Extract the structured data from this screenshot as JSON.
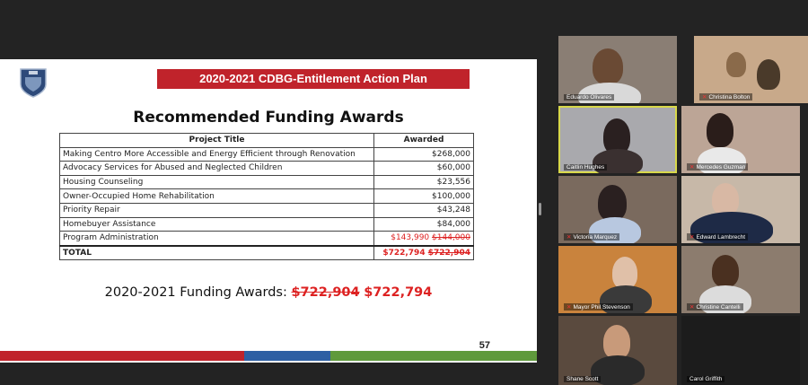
{
  "slide": {
    "banner_title": "2020-2021 CDBG-Entitlement Action Plan",
    "heading": "Recommended Funding Awards",
    "table": {
      "headers": [
        "Project Title",
        "Awarded"
      ],
      "rows": [
        {
          "title": "Making Centro More Accessible and Energy Efficient through Renovation",
          "amount": "$268,000"
        },
        {
          "title": "Advocacy Services for Abused and Neglected Children",
          "amount": "$60,000"
        },
        {
          "title": "Housing Counseling",
          "amount": "$23,556"
        },
        {
          "title": "Owner-Occupied Home Rehabilitation",
          "amount": "$100,000"
        },
        {
          "title": "Priority Repair",
          "amount": "$43,248"
        },
        {
          "title": "Homebuyer Assistance",
          "amount": "$84,000"
        }
      ],
      "program_admin": {
        "title": "Program Administration",
        "new_amount": "$143,990",
        "old_amount": "$144,000"
      },
      "total": {
        "title": "TOTAL",
        "new_amount": "$722,794",
        "old_amount": "$722,904"
      }
    },
    "summary": {
      "label": "2020-2021 Funding Awards:",
      "old_amount": "$722,904",
      "new_amount": "$722,794"
    },
    "page_number": "57",
    "colors": {
      "banner": "#c0232b",
      "bar_red": "#c0232b",
      "bar_blue": "#2e5fa3",
      "bar_green": "#5f9a3c"
    }
  },
  "participants": [
    {
      "name": "Eduardo Olivares"
    },
    {
      "name": "Christina Bolton"
    },
    {
      "name": "Caitlin Hughes"
    },
    {
      "name": "Mercedes Guzman"
    },
    {
      "name": "Victoria Marquez"
    },
    {
      "name": "Edward Lambrecht"
    },
    {
      "name": "Mayor Phil Stevenson"
    },
    {
      "name": "Christine Cantelli"
    },
    {
      "name": "Shane Scott"
    },
    {
      "name": "Carol Griffith"
    }
  ]
}
